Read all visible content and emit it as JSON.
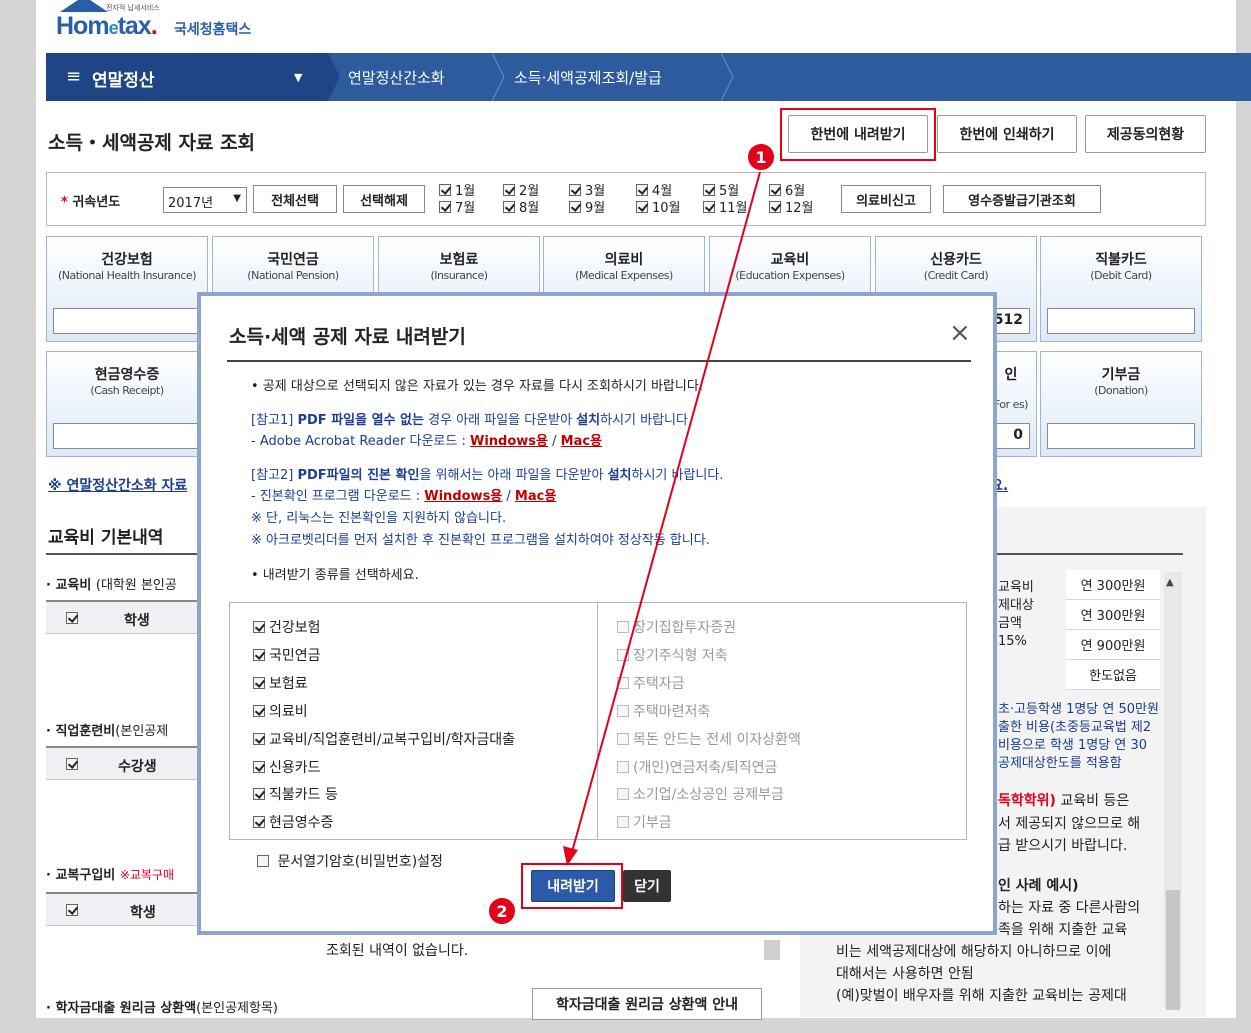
{
  "logo": {
    "small": "전자적 납세서비스",
    "main_prefix": "Hom",
    "main_e": "e",
    "main_suffix": "tax",
    "dot": ".",
    "korean": "국세청홈택스"
  },
  "nav": {
    "menu_title": "연말정산",
    "crumbs": [
      "연말정산간소화",
      "소득·세액공제조회/발급"
    ]
  },
  "page_title": "소득・세액공제 자료 조회",
  "top_buttons": [
    "한번에 내려받기",
    "한번에 인쇄하기",
    "제공동의현황"
  ],
  "badges": [
    "1",
    "2"
  ],
  "filter": {
    "year_label": "귀속년도",
    "year_value": "2017년",
    "select_all": "전체선택",
    "deselect": "선택해제",
    "months": [
      "1월",
      "2월",
      "3월",
      "4월",
      "5월",
      "6월",
      "7월",
      "8월",
      "9월",
      "10월",
      "11월",
      "12월"
    ],
    "medical_report": "의료비신고",
    "receipt_inquiry": "영수증발급기관조회"
  },
  "cards": [
    {
      "title": "건강보험",
      "sub": "(National Health Insurance)",
      "value": ""
    },
    {
      "title": "국민연금",
      "sub": "(National Pension)",
      "value": ""
    },
    {
      "title": "보험료",
      "sub": "(Insurance)",
      "value": ""
    },
    {
      "title": "의료비",
      "sub": "(Medical Expenses)",
      "value": ""
    },
    {
      "title": "교육비",
      "sub": "(Education Expenses)",
      "value": ""
    },
    {
      "title": "신용카드",
      "sub": "(Credit Card)",
      "value": "512"
    },
    {
      "title": "직불카드",
      "sub": "(Debit Card)",
      "value": ""
    },
    {
      "title": "현금영수증",
      "sub": "(Cash Receipt)",
      "value": ""
    },
    {
      "title": "인",
      "sub": "For es)",
      "value": "0"
    },
    {
      "title": "기부금",
      "sub": "(Donation)",
      "value": ""
    }
  ],
  "link_note": "※ 연말정산간소화 자료",
  "link_note_tail": "요.",
  "education": {
    "heading": "교육비 기본내역",
    "tuition_label": "교육비",
    "tuition_note": "(대학원 본인공",
    "student_col": "학생",
    "training_label": "직업훈련비",
    "training_note": "(본인공제",
    "trainee_col": "수강생",
    "uniform_label": "교복구입비",
    "uniform_note": "※교복구매",
    "empty_msg": "조회된 내역이 없습니다.",
    "loan_label": "학자금대출 원리금 상환액",
    "loan_note": "(본인공제항목)",
    "loan_button": "학자금대출 원리금 상환액 안내"
  },
  "right_panel": {
    "col_text": [
      "교육비",
      "제대상",
      "금액",
      "15%"
    ],
    "limits": [
      "연 300만원",
      "연 300만원",
      "연 900만원",
      "한도없음"
    ],
    "blue_lines": [
      "초·고등학생 1명당 연 50만원",
      "출한 비용(초중등교육법 제2",
      "비용으로 학생 1명당 연 30",
      "공제대상한도를 적용함"
    ],
    "red_part": "독학학위)",
    "after_red": " 교육비 등은",
    "lines": [
      "서 제공되지 않으므로 해",
      "급 받으시기 바랍니다."
    ],
    "example_title": "인 사례 예시)",
    "example_lines": [
      "하는 자료 중 다른사람의",
      "족을 위해 지출한 교육",
      "비는 세액공제대상에 해당하지 아니하므로 이에",
      "대해서는 사용하면 안됨",
      "(예)맞벌이 배우자를 위해 지출한 교육비는 공제대"
    ]
  },
  "modal": {
    "title": "소득·세액 공제 자료 내려받기",
    "close": "×",
    "notice": "• 공제 대상으로 선택되지 않은 자료가 있는 경우 자료를 다시 조회하시기 바랍니다.",
    "ref1_title_a": "[참고1] ",
    "ref1_title_b": "PDF 파일을 열수 없는",
    "ref1_title_c": " 경우  아래 파일을 다운받아 ",
    "ref1_title_d": "설치",
    "ref1_title_e": "하시기 바랍니다.",
    "ref1_line": "- Adobe Acrobat Reader 다운로드 : ",
    "win": "Windows용",
    "slash": " / ",
    "mac": "Mac용",
    "ref2_title_a": "[참고2] ",
    "ref2_title_b": "PDF파일의 진본 확인",
    "ref2_title_c": "을 위해서는 아래 파일을 다운받아 ",
    "ref2_title_d": "설치",
    "ref2_title_e": "하시기 바랍니다.",
    "ref2_line": "- 진본확인 프로그램 다운로드 : ",
    "note1": "※ 단, 리눅스는 진본확인을 지원하지 않습니다.",
    "note2": "※ 아크로벳리더를 먼저 설치한 후 진본확인 프로그램을 설치하여야 정상작동 합니다.",
    "select_prompt": "• 내려받기 종류를 선택하세요.",
    "left_options": [
      "건강보험",
      "국민연금",
      "보험료",
      "의료비",
      "교육비/직업훈련비/교복구입비/학자금대출",
      "신용카드",
      "직불카드 등",
      "현금영수증"
    ],
    "right_options": [
      "장기집합투자증권",
      "장기주식형 저축",
      "주택자금",
      "주택마련저축",
      "목돈 안드는 전세 이자상환액",
      "(개인)연금저축/퇴직연금",
      "소기업/소상공인 공제부금",
      "기부금"
    ],
    "password_option": "문서열기암호(비밀번호)설정",
    "download_btn": "내려받기",
    "close_btn": "닫기"
  },
  "colors": {
    "nav": "#2e5a9e",
    "highlight": "#e2001a",
    "modal_border": "#8ba5cf",
    "primary_btn": "#2d5aa8",
    "dark_btn": "#333333"
  }
}
